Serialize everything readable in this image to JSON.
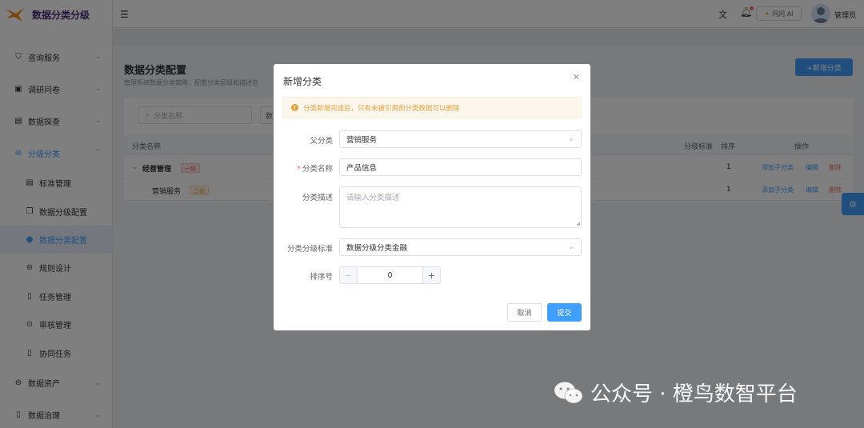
{
  "app": {
    "title": "数据分类分级",
    "brand_color": "#409eff"
  },
  "sidebar": {
    "items": [
      {
        "label": "咨询服务",
        "icon": "service-icon"
      },
      {
        "label": "调研问卷",
        "icon": "survey-icon"
      },
      {
        "label": "数据探查",
        "icon": "document-icon"
      },
      {
        "label": "分级分类",
        "icon": "grid-icon",
        "expanded": true
      },
      {
        "label": "数据资产",
        "icon": "database-icon"
      },
      {
        "label": "数据治理",
        "icon": "governance-icon"
      }
    ],
    "sub_items": [
      {
        "label": "标准管理",
        "icon": "document-icon"
      },
      {
        "label": "数据分级配置",
        "icon": "copy-icon"
      },
      {
        "label": "数据分类配置",
        "icon": "user-icon",
        "selected": true
      },
      {
        "label": "规则设计",
        "icon": "printer-icon"
      },
      {
        "label": "任务管理",
        "icon": "clipboard-icon"
      },
      {
        "label": "审核管理",
        "icon": "location-icon"
      },
      {
        "label": "协同任务",
        "icon": "clipboard-icon"
      }
    ]
  },
  "header": {
    "ai_label": "问问 AI",
    "user_name": "管理员"
  },
  "page": {
    "title": "数据分类配置",
    "description": "管理系统数据分类策略，配置分类层级和描述信",
    "add_button": "+新增分类",
    "search_placeholder": "分类名称",
    "filter_label": "数",
    "table": {
      "columns": [
        "分类名称",
        "分级标准",
        "排序",
        "操作"
      ],
      "rows": [
        {
          "name": "经营管理",
          "level": "一级",
          "sort": "1",
          "ops": [
            "添加子分类",
            "编辑",
            "删除"
          ]
        },
        {
          "name": "营销服务",
          "level": "二级",
          "sort": "1",
          "ops": [
            "添加子分类",
            "编辑",
            "删除"
          ]
        }
      ]
    }
  },
  "dialog": {
    "title": "新增分类",
    "alert": "分类新增完成后，只有未被引用的分类数据可以删除",
    "fields": {
      "parent_label": "父分类",
      "parent_value": "营销服务",
      "name_label": "分类名称",
      "name_value": "产品信息",
      "desc_label": "分类描述",
      "desc_placeholder": "请输入分类描述",
      "standard_label": "分类分级标准",
      "standard_value": "数据分级分类金融",
      "order_label": "排序号",
      "order_value": "0"
    },
    "cancel": "取消",
    "submit": "提交"
  },
  "watermark": "公众号 · 橙鸟数智平台"
}
